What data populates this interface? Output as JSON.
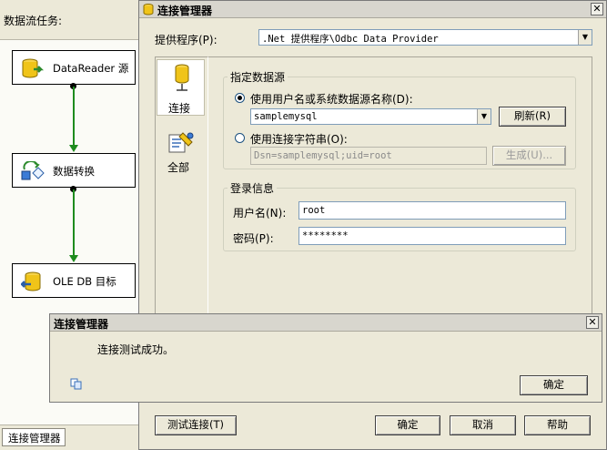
{
  "designer": {
    "task_label": "数据流任务:",
    "components": [
      {
        "label": "DataReader 源",
        "icon": "data-source-icon"
      },
      {
        "label": "数据转换",
        "icon": "data-conversion-icon"
      },
      {
        "label": "OLE DB 目标",
        "icon": "ole-db-destination-icon"
      }
    ],
    "bottom_tab": "连接管理器"
  },
  "dialog": {
    "title": "连接管理器",
    "provider_label": "提供程序(P):",
    "provider_value": ".Net 提供程序\\Odbc Data Provider",
    "nav": [
      {
        "label": "连接",
        "icon": "connection-icon",
        "selected": true
      },
      {
        "label": "全部",
        "icon": "all-properties-icon",
        "selected": false
      }
    ],
    "datasource_group": {
      "legend": "指定数据源",
      "dsn_radio_label": "使用用户名或系统数据源名称(D):",
      "dsn_value": "samplemysql",
      "refresh_button": "刷新(R)",
      "connstr_radio_label": "使用连接字符串(O):",
      "connstr_value": "Dsn=samplemysql;uid=root",
      "build_button": "生成(U)..."
    },
    "login_group": {
      "legend": "登录信息",
      "username_label": "用户名(N):",
      "username_value": "root",
      "password_label": "密码(P):",
      "password_value": "********"
    },
    "buttons": {
      "test": "测试连接(T)",
      "ok": "确定",
      "cancel": "取消",
      "help": "帮助"
    }
  },
  "message_box": {
    "title": "连接管理器",
    "message": "连接测试成功。",
    "ok_button": "确定",
    "copy_icon": "copy-icon"
  },
  "colors": {
    "dialog_bg": "#ece9d8",
    "flow_arrow": "#1e8c1e",
    "cylinder": "#f0c419"
  }
}
